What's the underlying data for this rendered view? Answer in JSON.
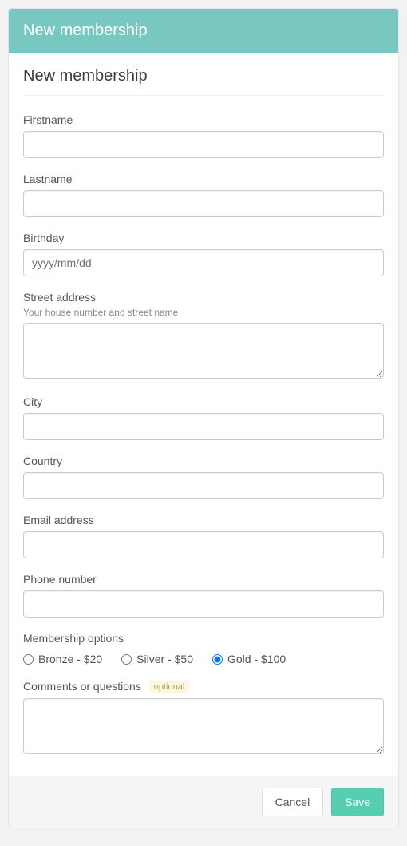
{
  "header": {
    "title": "New membership"
  },
  "form": {
    "title": "New membership",
    "fields": {
      "firstname": {
        "label": "Firstname",
        "value": ""
      },
      "lastname": {
        "label": "Lastname",
        "value": ""
      },
      "birthday": {
        "label": "Birthday",
        "placeholder": "yyyy/mm/dd",
        "value": ""
      },
      "street": {
        "label": "Street address",
        "help": "Your house number and street name",
        "value": ""
      },
      "city": {
        "label": "City",
        "value": ""
      },
      "country": {
        "label": "Country",
        "value": ""
      },
      "email": {
        "label": "Email address",
        "value": ""
      },
      "phone": {
        "label": "Phone number",
        "value": ""
      },
      "membership": {
        "label": "Membership options",
        "options": [
          {
            "label": "Bronze - $20",
            "checked": false
          },
          {
            "label": "Silver - $50",
            "checked": false
          },
          {
            "label": "Gold - $100",
            "checked": true
          }
        ]
      },
      "comments": {
        "label": "Comments or questions",
        "badge": "optional",
        "value": ""
      }
    }
  },
  "footer": {
    "cancel_label": "Cancel",
    "save_label": "Save"
  }
}
